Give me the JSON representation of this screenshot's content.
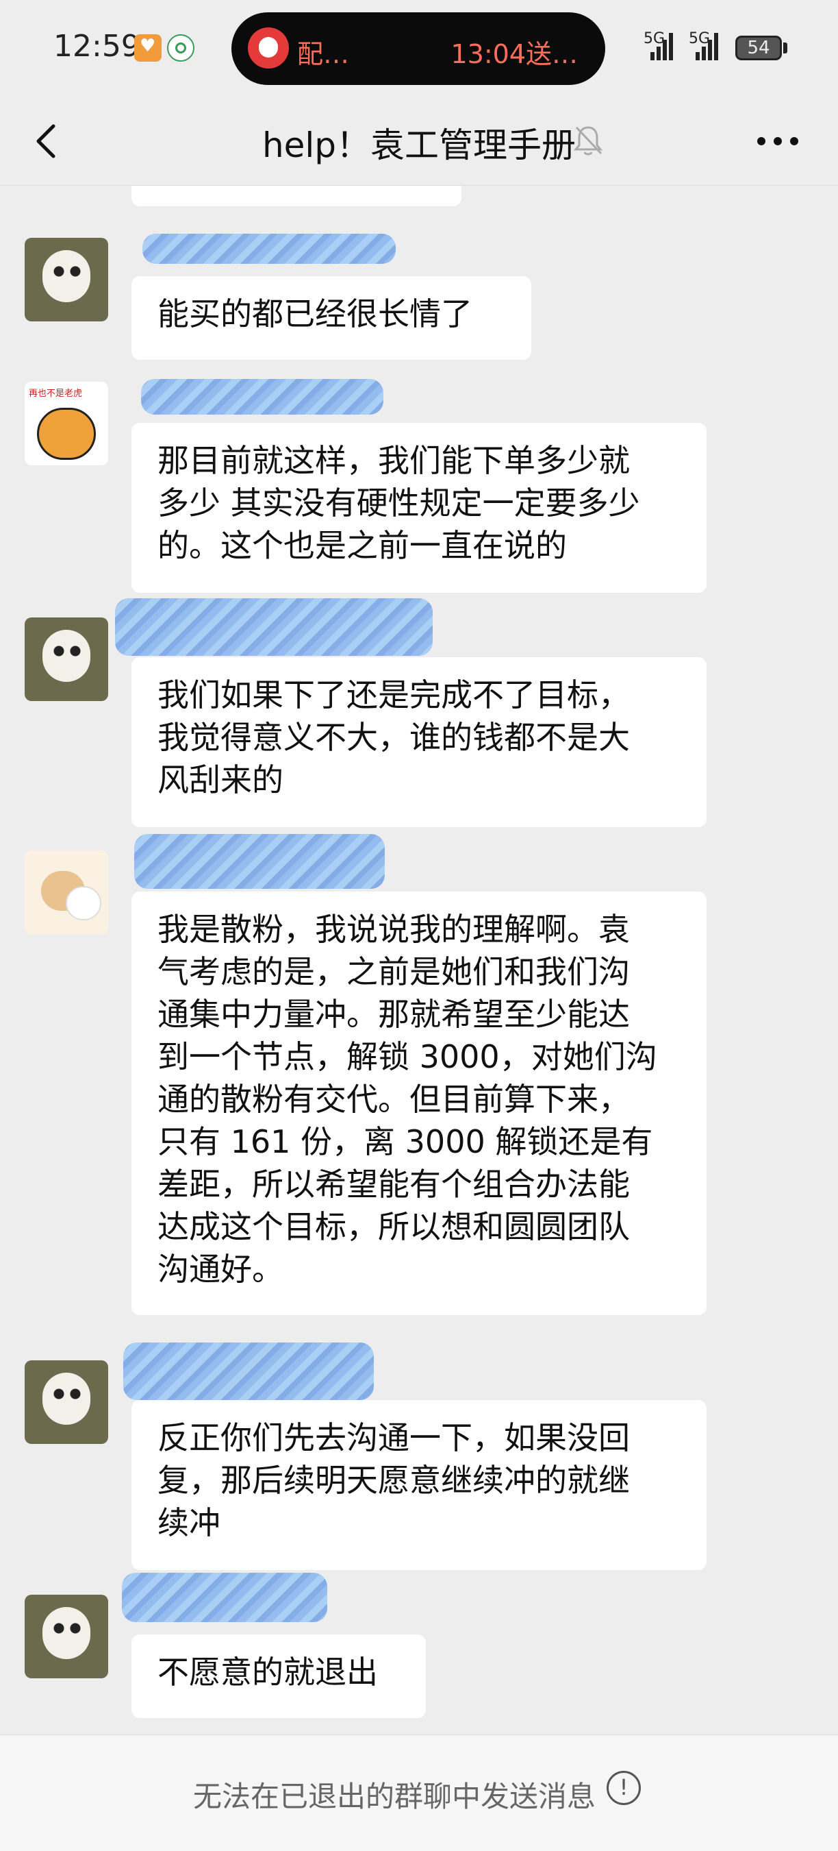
{
  "status_bar": {
    "time": "12:59",
    "island_left": "配…",
    "island_right": "13:04送…",
    "network1": "5G",
    "network2": "5G",
    "battery": "54"
  },
  "header": {
    "title": "help！袁工管理手册",
    "back_icon": "chevron-left-icon",
    "mute_icon": "bell-muted-icon",
    "more_icon": "more-dots-icon"
  },
  "messages": [
    {
      "avatar": "panda",
      "text": "能买的都已经很长情了"
    },
    {
      "avatar": "tiger",
      "text": "那目前就这样，我们能下单多少就\n多少 其实没有硬性规定一定要多少\n的。这个也是之前一直在说的"
    },
    {
      "avatar": "panda",
      "text": "我们如果下了还是完成不了目标，\n我觉得意义不大，谁的钱都不是大\n风刮来的"
    },
    {
      "avatar": "bear",
      "text": "我是散粉，我说说我的理解啊。袁\n气考虑的是，之前是她们和我们沟\n通集中力量冲。那就希望至少能达\n到一个节点，解锁 3000，对她们沟\n通的散粉有交代。但目前算下来，\n只有 161 份，离 3000 解锁还是有\n差距，所以希望能有个组合办法能\n达成这个目标，所以想和圆圆团队\n沟通好。"
    },
    {
      "avatar": "panda",
      "text": "反正你们先去沟通一下，如果没回\n复，那后续明天愿意继续冲的就继\n续冲"
    },
    {
      "avatar": "panda",
      "text": "不愿意的就退出"
    }
  ],
  "footer": {
    "notice": "无法在已退出的群聊中发送消息",
    "notice_icon": "exclamation-circle-icon"
  }
}
